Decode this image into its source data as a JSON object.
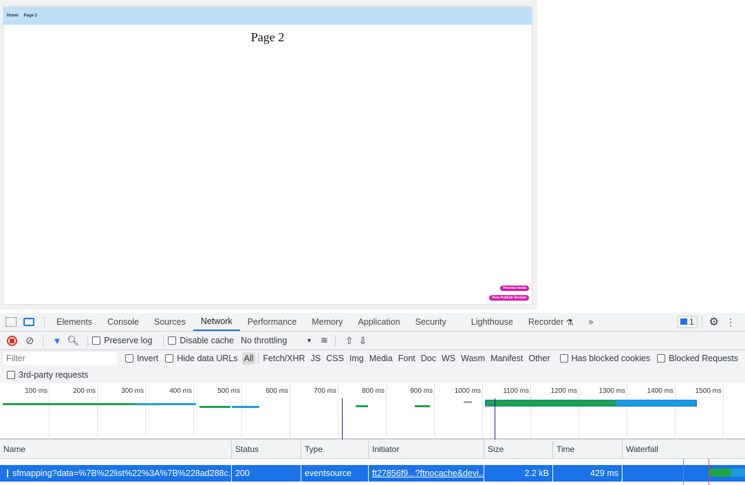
{
  "page": {
    "nav": [
      "Home",
      "Page 2"
    ],
    "title": "Page 2",
    "preview_button": "Preview mode",
    "publish_button": "View Publish Version",
    "accent": "#d91aa8",
    "nav_bg": "#bee0f7"
  },
  "devtools": {
    "tabs": [
      "Elements",
      "Console",
      "Sources",
      "Network",
      "Performance",
      "Memory",
      "Application",
      "Security",
      "Lighthouse",
      "Recorder"
    ],
    "active_tab": "Network",
    "more_tabs": "»",
    "issues_count": "1",
    "toolbar": {
      "preserve_log": "Preserve log",
      "disable_cache": "Disable cache",
      "throttling": "No throttling"
    },
    "filter": {
      "placeholder": "Filter",
      "invert": "Invert",
      "hide_data_urls": "Hide data URLs",
      "types": [
        "All",
        "Fetch/XHR",
        "JS",
        "CSS",
        "Img",
        "Media",
        "Font",
        "Doc",
        "WS",
        "Wasm",
        "Manifest",
        "Other"
      ],
      "active_type": "All",
      "has_blocked_cookies": "Has blocked cookies",
      "blocked_requests": "Blocked Requests",
      "third_party": "3rd-party requests"
    },
    "timeline_ticks": [
      "100 ms",
      "200 ms",
      "300 ms",
      "400 ms",
      "500 ms",
      "600 ms",
      "700 ms",
      "800 ms",
      "900 ms",
      "1000 ms",
      "1100 ms",
      "1200 ms",
      "1300 ms",
      "1400 ms",
      "1500 ms"
    ],
    "columns": [
      "Name",
      "Status",
      "Type",
      "Initiator",
      "Size",
      "Time",
      "Waterfall"
    ],
    "selected_row": {
      "name": "sfmapping?data=%7B%22list%22%3A%7B%228ad288c...",
      "status": "200",
      "type": "eventsource",
      "initiator": "ft27856f9...?ftnocache&devi...",
      "size": "2.2 kB",
      "time": "429 ms"
    }
  }
}
